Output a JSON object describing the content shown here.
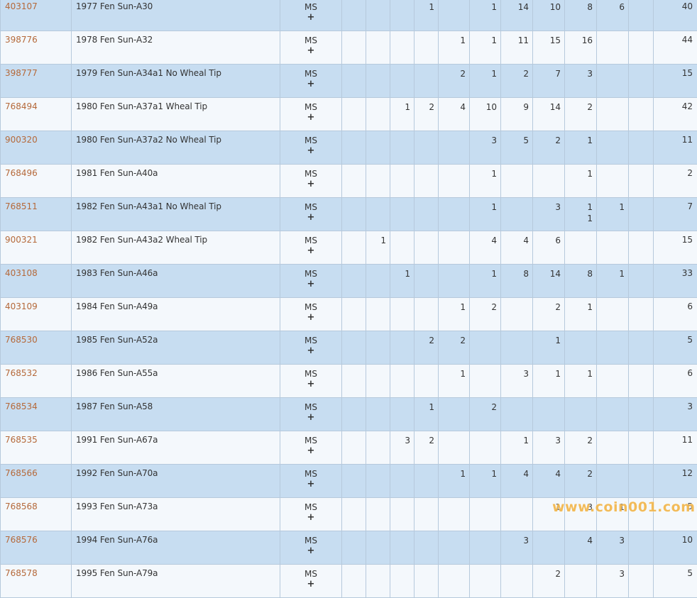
{
  "table": {
    "rows": [
      {
        "cert": "403107",
        "desc": "1977 Fen Sun-A30",
        "grade": "MS",
        "plus": "+",
        "counts": [
          "",
          "",
          "",
          "1",
          "",
          "1",
          "14",
          "10",
          "8",
          "6",
          ""
        ],
        "extra": [
          "",
          "",
          "",
          "",
          "",
          "",
          "",
          "",
          "",
          "",
          ""
        ],
        "total": "40"
      },
      {
        "cert": "398776",
        "desc": "1978 Fen Sun-A32",
        "grade": "MS",
        "plus": "+",
        "counts": [
          "",
          "",
          "",
          "",
          "1",
          "1",
          "11",
          "15",
          "16",
          "",
          ""
        ],
        "extra": [
          "",
          "",
          "",
          "",
          "",
          "",
          "",
          "",
          "",
          "",
          ""
        ],
        "total": "44"
      },
      {
        "cert": "398777",
        "desc": "1979 Fen Sun-A34a1 No Wheal Tip",
        "grade": "MS",
        "plus": "+",
        "counts": [
          "",
          "",
          "",
          "",
          "2",
          "1",
          "2",
          "7",
          "3",
          "",
          ""
        ],
        "extra": [
          "",
          "",
          "",
          "",
          "",
          "",
          "",
          "",
          "",
          "",
          ""
        ],
        "total": "15"
      },
      {
        "cert": "768494",
        "desc": "1980 Fen Sun-A37a1 Wheal Tip",
        "grade": "MS",
        "plus": "+",
        "counts": [
          "",
          "",
          "1",
          "2",
          "4",
          "10",
          "9",
          "14",
          "2",
          "",
          ""
        ],
        "extra": [
          "",
          "",
          "",
          "",
          "",
          "",
          "",
          "",
          "",
          "",
          ""
        ],
        "total": "42"
      },
      {
        "cert": "900320",
        "desc": "1980 Fen Sun-A37a2 No Wheal Tip",
        "grade": "MS",
        "plus": "+",
        "counts": [
          "",
          "",
          "",
          "",
          "",
          "3",
          "5",
          "2",
          "1",
          "",
          ""
        ],
        "extra": [
          "",
          "",
          "",
          "",
          "",
          "",
          "",
          "",
          "",
          "",
          ""
        ],
        "total": "11"
      },
      {
        "cert": "768496",
        "desc": "1981 Fen Sun-A40a",
        "grade": "MS",
        "plus": "+",
        "counts": [
          "",
          "",
          "",
          "",
          "",
          "1",
          "",
          "",
          "1",
          "",
          ""
        ],
        "extra": [
          "",
          "",
          "",
          "",
          "",
          "",
          "",
          "",
          "",
          "",
          ""
        ],
        "total": "2"
      },
      {
        "cert": "768511",
        "desc": "1982 Fen Sun-A43a1 No Wheal Tip",
        "grade": "MS",
        "plus": "+",
        "counts": [
          "",
          "",
          "",
          "",
          "",
          "1",
          "",
          "3",
          "1",
          "1",
          ""
        ],
        "extra": [
          "",
          "",
          "",
          "",
          "",
          "",
          "",
          "",
          "1",
          "",
          ""
        ],
        "total": "7"
      },
      {
        "cert": "900321",
        "desc": "1982 Fen Sun-A43a2 Wheal Tip",
        "grade": "MS",
        "plus": "+",
        "counts": [
          "",
          "1",
          "",
          "",
          "",
          "4",
          "4",
          "6",
          "",
          "",
          ""
        ],
        "extra": [
          "",
          "",
          "",
          "",
          "",
          "",
          "",
          "",
          "",
          "",
          ""
        ],
        "total": "15"
      },
      {
        "cert": "403108",
        "desc": "1983 Fen Sun-A46a",
        "grade": "MS",
        "plus": "+",
        "counts": [
          "",
          "",
          "1",
          "",
          "",
          "1",
          "8",
          "14",
          "8",
          "1",
          ""
        ],
        "extra": [
          "",
          "",
          "",
          "",
          "",
          "",
          "",
          "",
          "",
          "",
          ""
        ],
        "total": "33"
      },
      {
        "cert": "403109",
        "desc": "1984 Fen Sun-A49a",
        "grade": "MS",
        "plus": "+",
        "counts": [
          "",
          "",
          "",
          "",
          "1",
          "2",
          "",
          "2",
          "1",
          "",
          ""
        ],
        "extra": [
          "",
          "",
          "",
          "",
          "",
          "",
          "",
          "",
          "",
          "",
          ""
        ],
        "total": "6"
      },
      {
        "cert": "768530",
        "desc": "1985 Fen Sun-A52a",
        "grade": "MS",
        "plus": "+",
        "counts": [
          "",
          "",
          "",
          "2",
          "2",
          "",
          "",
          "1",
          "",
          "",
          ""
        ],
        "extra": [
          "",
          "",
          "",
          "",
          "",
          "",
          "",
          "",
          "",
          "",
          ""
        ],
        "total": "5"
      },
      {
        "cert": "768532",
        "desc": "1986 Fen Sun-A55a",
        "grade": "MS",
        "plus": "+",
        "counts": [
          "",
          "",
          "",
          "",
          "1",
          "",
          "3",
          "1",
          "1",
          "",
          ""
        ],
        "extra": [
          "",
          "",
          "",
          "",
          "",
          "",
          "",
          "",
          "",
          "",
          ""
        ],
        "total": "6"
      },
      {
        "cert": "768534",
        "desc": "1987 Fen Sun-A58",
        "grade": "MS",
        "plus": "+",
        "counts": [
          "",
          "",
          "",
          "1",
          "",
          "2",
          "",
          "",
          "",
          "",
          ""
        ],
        "extra": [
          "",
          "",
          "",
          "",
          "",
          "",
          "",
          "",
          "",
          "",
          ""
        ],
        "total": "3"
      },
      {
        "cert": "768535",
        "desc": "1991 Fen Sun-A67a",
        "grade": "MS",
        "plus": "+",
        "counts": [
          "",
          "",
          "3",
          "2",
          "",
          "",
          "1",
          "3",
          "2",
          "",
          ""
        ],
        "extra": [
          "",
          "",
          "",
          "",
          "",
          "",
          "",
          "",
          "",
          "",
          ""
        ],
        "total": "11"
      },
      {
        "cert": "768566",
        "desc": "1992 Fen Sun-A70a",
        "grade": "MS",
        "plus": "+",
        "counts": [
          "",
          "",
          "",
          "",
          "1",
          "1",
          "4",
          "4",
          "2",
          "",
          ""
        ],
        "extra": [
          "",
          "",
          "",
          "",
          "",
          "",
          "",
          "",
          "",
          "",
          ""
        ],
        "total": "12"
      },
      {
        "cert": "768568",
        "desc": "1993 Fen Sun-A73a",
        "grade": "MS",
        "plus": "+",
        "counts": [
          "",
          "",
          "",
          "",
          "",
          "",
          "",
          "1",
          "3",
          "1",
          ""
        ],
        "extra": [
          "",
          "",
          "",
          "",
          "",
          "",
          "",
          "",
          "",
          "",
          ""
        ],
        "total": "5"
      },
      {
        "cert": "768576",
        "desc": "1994 Fen Sun-A76a",
        "grade": "MS",
        "plus": "+",
        "counts": [
          "",
          "",
          "",
          "",
          "",
          "",
          "3",
          "",
          "4",
          "3",
          ""
        ],
        "extra": [
          "",
          "",
          "",
          "",
          "",
          "",
          "",
          "",
          "",
          "",
          ""
        ],
        "total": "10"
      },
      {
        "cert": "768578",
        "desc": "1995 Fen Sun-A79a",
        "grade": "MS",
        "plus": "+",
        "counts": [
          "",
          "",
          "",
          "",
          "",
          "",
          "",
          "2",
          "",
          "3",
          ""
        ],
        "extra": [
          "",
          "",
          "",
          "",
          "",
          "",
          "",
          "",
          "",
          "",
          ""
        ],
        "total": "5"
      }
    ]
  },
  "watermark": "www.coin001.com"
}
